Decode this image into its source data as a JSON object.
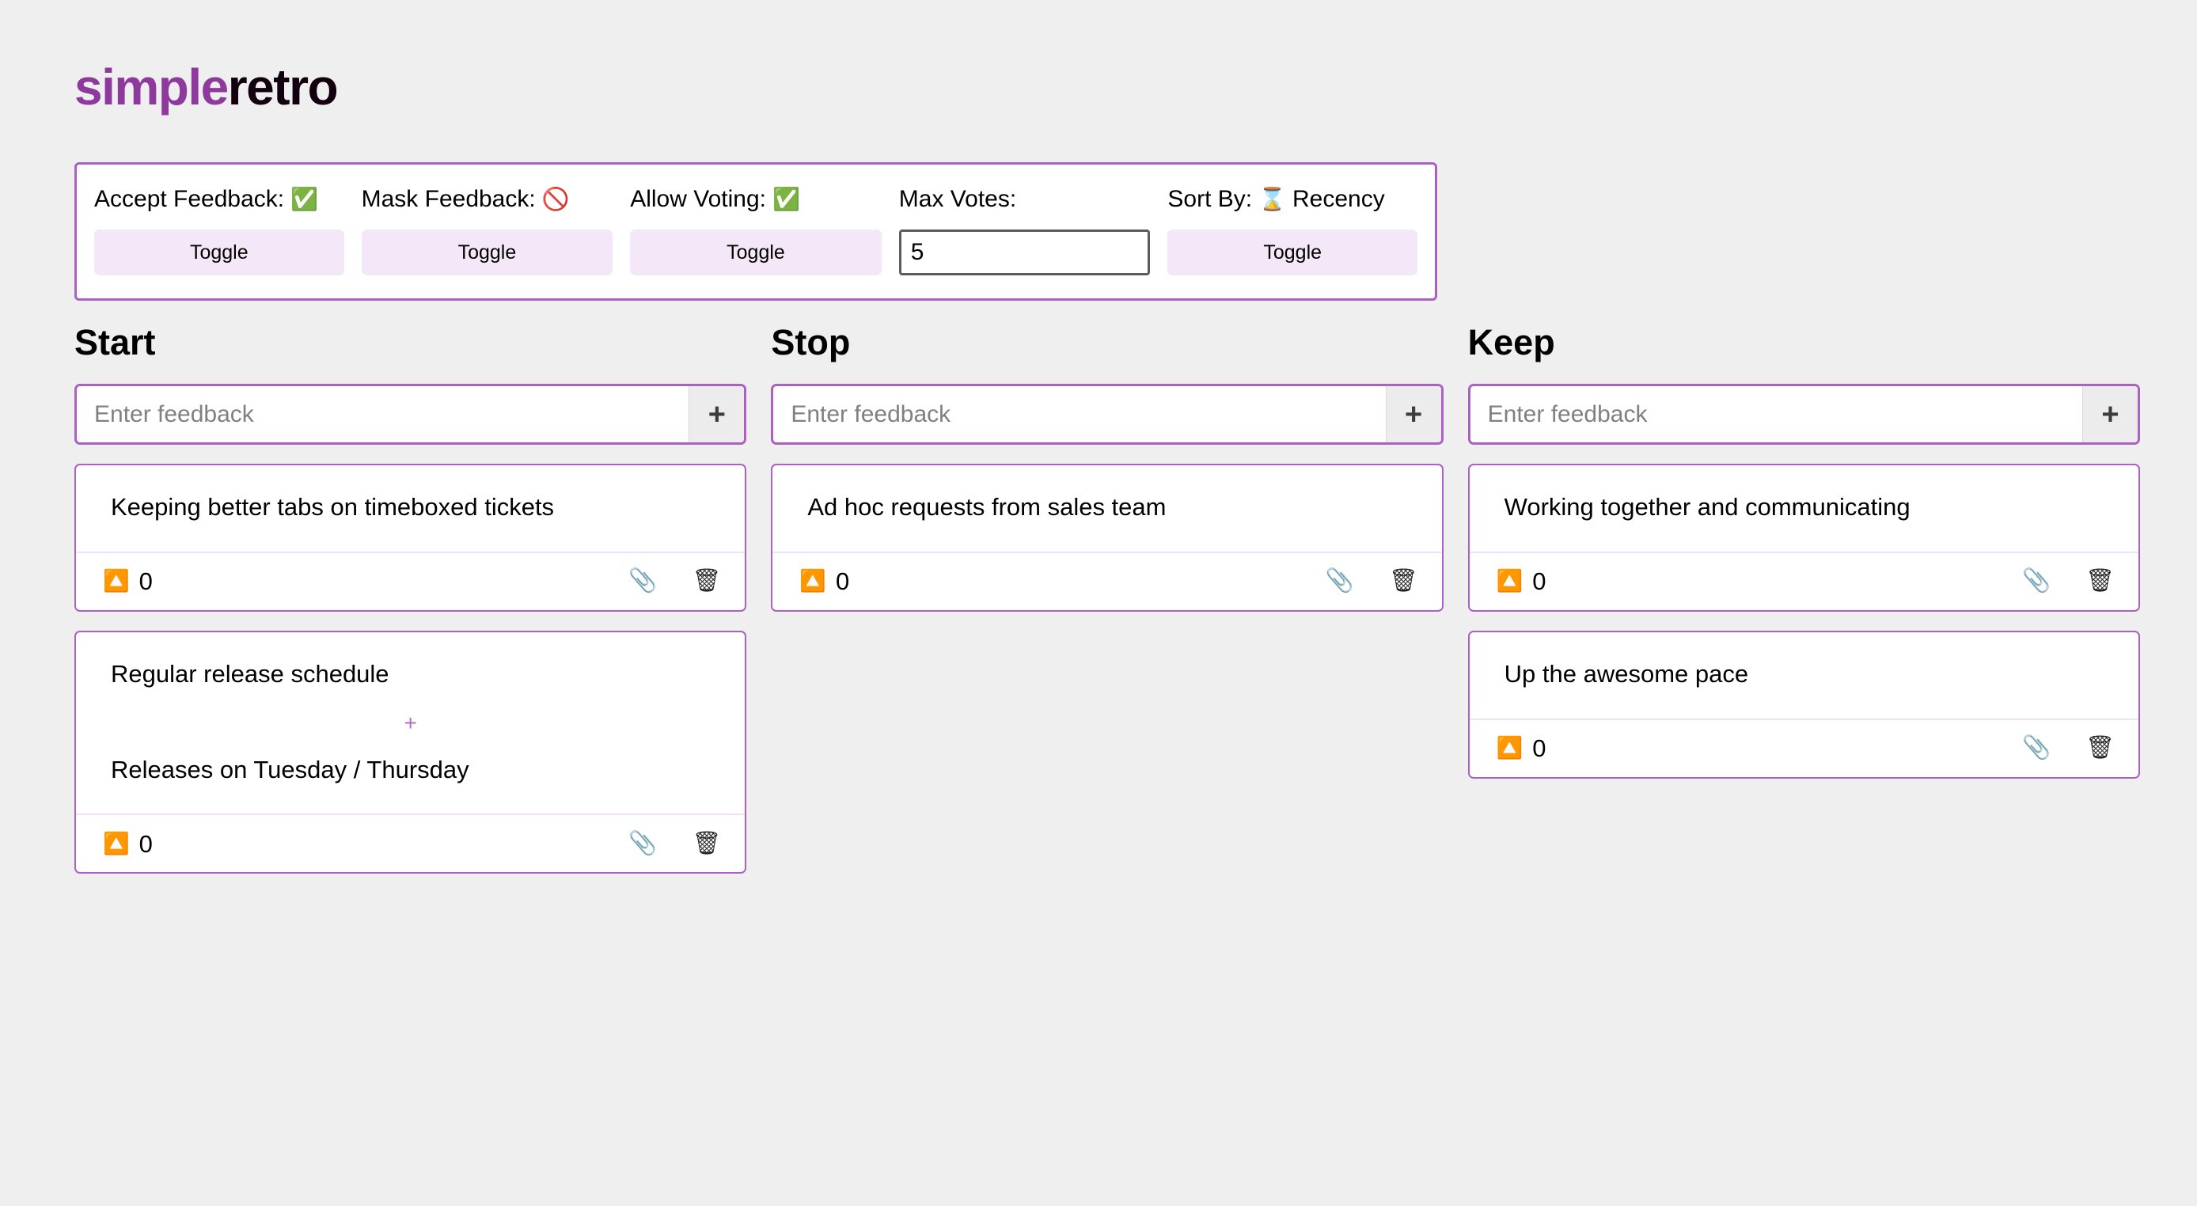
{
  "app": {
    "logo_primary": "simple",
    "logo_secondary": "retro"
  },
  "settings": {
    "accept_feedback": {
      "label": "Accept Feedback:",
      "status_icon": "✅",
      "status_icon_name": "check-mark-button",
      "toggle_label": "Toggle"
    },
    "mask_feedback": {
      "label": "Mask Feedback:",
      "status_icon": "🚫",
      "status_icon_name": "prohibited-sign",
      "toggle_label": "Toggle"
    },
    "allow_voting": {
      "label": "Allow Voting:",
      "status_icon": "✅",
      "status_icon_name": "check-mark-button",
      "toggle_label": "Toggle"
    },
    "max_votes": {
      "label": "Max Votes:",
      "value": "5"
    },
    "sort_by": {
      "label": "Sort By:",
      "status_icon": "⌛",
      "status_icon_name": "hourglass",
      "value": "Recency",
      "toggle_label": "Toggle"
    }
  },
  "board": {
    "entry_placeholder": "Enter feedback",
    "add_label": "+",
    "merge_separator": "+",
    "vote_icon": "🔼",
    "attach_icon": "📎",
    "delete_icon": "🗑",
    "columns": [
      {
        "title": "Start",
        "cards": [
          {
            "texts": [
              "Keeping better tabs on timeboxed tickets"
            ],
            "votes": "0"
          },
          {
            "texts": [
              "Regular release schedule",
              "Releases on Tuesday / Thursday"
            ],
            "votes": "0"
          }
        ]
      },
      {
        "title": "Stop",
        "cards": [
          {
            "texts": [
              "Ad hoc requests from sales team"
            ],
            "votes": "0"
          }
        ]
      },
      {
        "title": "Keep",
        "cards": [
          {
            "texts": [
              "Working together and communicating"
            ],
            "votes": "0"
          },
          {
            "texts": [
              "Up the awesome pace"
            ],
            "votes": "0"
          }
        ]
      }
    ]
  },
  "colors": {
    "brand_purple": "#8e3a9c",
    "border_purple": "#ad60c4",
    "toggle_bg": "#f4e7f7",
    "page_bg": "#efefef"
  }
}
